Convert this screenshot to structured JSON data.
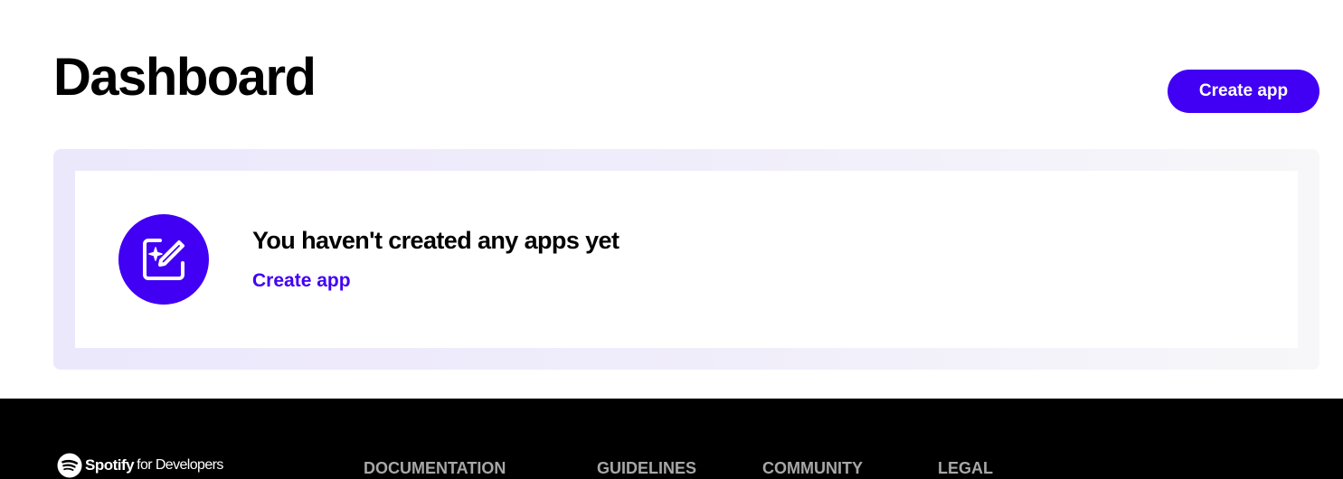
{
  "header": {
    "title": "Dashboard",
    "create_button_label": "Create app"
  },
  "empty_state": {
    "icon": "edit-sparkle-icon",
    "title": "You haven't created any apps yet",
    "create_link_label": "Create app"
  },
  "footer": {
    "logo": {
      "icon": "spotify-logo-icon",
      "brand": "Spotify",
      "suffix": "for Developers"
    },
    "nav": [
      {
        "label": "DOCUMENTATION"
      },
      {
        "label": "GUIDELINES"
      },
      {
        "label": "COMMUNITY"
      },
      {
        "label": "LEGAL"
      }
    ]
  },
  "colors": {
    "accent": "#4100f4",
    "footer_background": "#000000",
    "footer_nav_text": "#a7a7a7",
    "panel_background": "#ece8fc"
  }
}
